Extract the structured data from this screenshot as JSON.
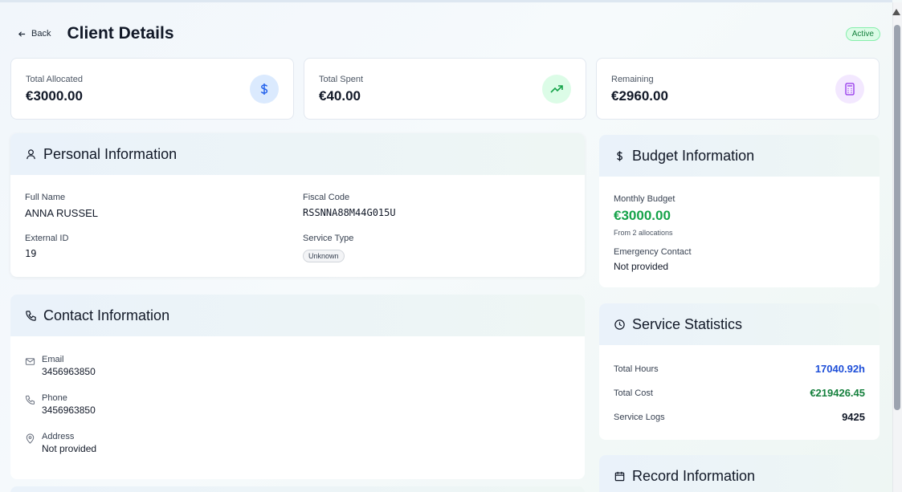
{
  "header": {
    "back_label": "Back",
    "title": "Client Details",
    "status": "Active"
  },
  "stats": [
    {
      "label": "Total Allocated",
      "value": "€3000.00",
      "icon": "dollar-icon",
      "color": "#3b82f6"
    },
    {
      "label": "Total Spent",
      "value": "€40.00",
      "icon": "trending-up-icon",
      "color": "#16a34a"
    },
    {
      "label": "Remaining",
      "value": "€2960.00",
      "icon": "calculator-icon",
      "color": "#9333ea"
    }
  ],
  "personal": {
    "title": "Personal Information",
    "full_name_label": "Full Name",
    "full_name": "ANNA RUSSEL",
    "fiscal_code_label": "Fiscal Code",
    "fiscal_code": "RSSNNA88M44G015U",
    "external_id_label": "External ID",
    "external_id": "19",
    "service_type_label": "Service Type",
    "service_type": "Unknown"
  },
  "contact": {
    "title": "Contact Information",
    "email_label": "Email",
    "email": "3456963850",
    "phone_label": "Phone",
    "phone": "3456963850",
    "address_label": "Address",
    "address": "Not provided"
  },
  "budget": {
    "title": "Budget Information",
    "monthly_label": "Monthly Budget",
    "monthly_value": "€3000.00",
    "allocations_note": "From 2 allocations",
    "emergency_label": "Emergency Contact",
    "emergency_value": "Not provided"
  },
  "service_stats": {
    "title": "Service Statistics",
    "hours_label": "Total Hours",
    "hours_value": "17040.92h",
    "cost_label": "Total Cost",
    "cost_value": "€219426.45",
    "logs_label": "Service Logs",
    "logs_value": "9425"
  },
  "record": {
    "title": "Record Information"
  },
  "colors": {
    "hours": "#1d4ed8",
    "cost": "#15803d",
    "monthly": "#16a34a"
  }
}
